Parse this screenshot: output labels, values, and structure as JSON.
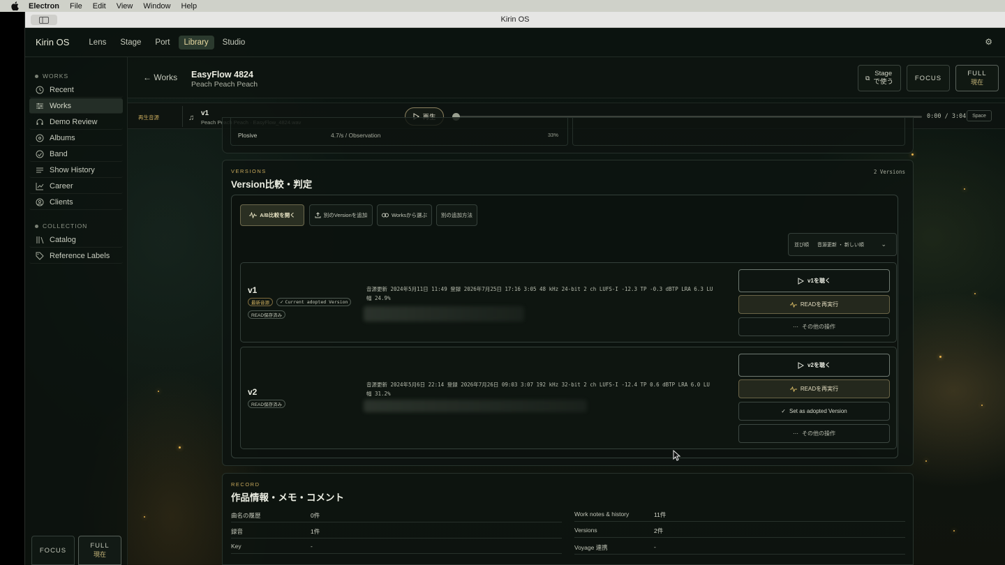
{
  "menubar": {
    "app": "Electron",
    "items": [
      "File",
      "Edit",
      "View",
      "Window",
      "Help"
    ]
  },
  "window": {
    "title": "Kirin OS"
  },
  "topnav": {
    "brand": "Kirin OS",
    "tabs": [
      "Lens",
      "Stage",
      "Port",
      "Library",
      "Studio"
    ],
    "active_tab": "Library"
  },
  "sidebar": {
    "works_heading": "WORKS",
    "works_items": [
      {
        "label": "Recent",
        "icon": "clock-icon"
      },
      {
        "label": "Works",
        "icon": "sliders-icon",
        "active": true
      },
      {
        "label": "Demo Review",
        "icon": "headphones-icon"
      },
      {
        "label": "Albums",
        "icon": "disc-icon"
      },
      {
        "label": "Band",
        "icon": "users-icon"
      },
      {
        "label": "Show History",
        "icon": "list-icon"
      },
      {
        "label": "Career",
        "icon": "chart-icon"
      },
      {
        "label": "Clients",
        "icon": "user-icon"
      }
    ],
    "collection_heading": "COLLECTION",
    "collection_items": [
      {
        "label": "Catalog",
        "icon": "library-icon"
      },
      {
        "label": "Reference Labels",
        "icon": "tag-icon"
      }
    ],
    "footer": {
      "focus": "FOCUS",
      "full": "FULL",
      "full_sub": "現在"
    }
  },
  "header": {
    "back": "← Works",
    "title": "EasyFlow 4824",
    "subtitle": "Peach Peach Peach",
    "stage_line1": "Stage",
    "stage_line2": "で使う",
    "focus": "FOCUS",
    "full": "FULL",
    "full_sub": "現在"
  },
  "player": {
    "label": "再生音源",
    "version": "v1",
    "file": "Peach Peach Peach · EasyFlow_4824.wav",
    "play": "再生",
    "time": "0:00 / 3:04",
    "shortcut": "Space",
    "progress": 0
  },
  "plosive": {
    "label": "Plosive",
    "value": "4.7/s / Observation",
    "percent": "33%"
  },
  "versions": {
    "eyebrow": "VERSIONS",
    "title": "Version比較・判定",
    "count": "2 Versions",
    "toolbar": {
      "ab_compare": "A/B比較を開く",
      "add_version": "別のVersionを追加",
      "choose_from_works": "Worksから選ぶ",
      "other_add": "別の追加方法"
    },
    "sort": {
      "label": "並び順",
      "value": "音源更新 ・ 新しい順"
    },
    "items": [
      {
        "name": "v1",
        "badges": [
          "最新音源",
          "Current adopted Version",
          "READ保存済み"
        ],
        "meta_line1": "音源更新 2024年5月11日 11:49 登録 2026年7月25日 17:16 3:05 48 kHz 24-bit 2 ch LUFS-I -12.3 TP -0.3 dBTP LRA 6.3 LU",
        "meta_line2": "幅 24.9%",
        "listen": "v1を聴く",
        "rerun": "READを再実行",
        "more": "その他の操作"
      },
      {
        "name": "v2",
        "badges": [
          "READ保存済み"
        ],
        "meta_line1": "音源更新 2024年5月6日 22:14 登録 2026年7月26日 09:03 3:07 192 kHz 32-bit 2 ch LUFS-I -12.4 TP 0.6 dBTP LRA 6.0 LU",
        "meta_line2": "幅 31.2%",
        "listen": "v2を聴く",
        "rerun": "READを再実行",
        "adopt": "Set as adopted Version",
        "more": "その他の操作"
      }
    ]
  },
  "record": {
    "eyebrow": "RECORD",
    "title": "作品情報・メモ・コメント",
    "left_rows": [
      {
        "k": "曲名の履歴",
        "v": "0件"
      },
      {
        "k": "録音",
        "v": "1件"
      },
      {
        "k": "Key",
        "v": "-"
      }
    ],
    "right_rows": [
      {
        "k": "Work notes & history",
        "v": "11件"
      },
      {
        "k": "Versions",
        "v": "2件"
      },
      {
        "k": "Voyage 連携",
        "v": "-"
      }
    ]
  }
}
